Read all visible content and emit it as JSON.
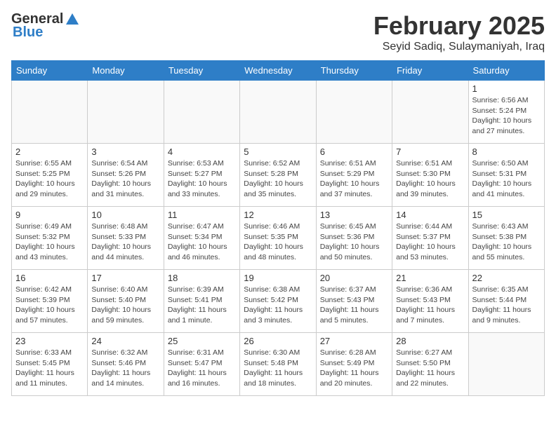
{
  "header": {
    "logo_general": "General",
    "logo_blue": "Blue",
    "month_title": "February 2025",
    "subtitle": "Seyid Sadiq, Sulaymaniyah, Iraq"
  },
  "weekdays": [
    "Sunday",
    "Monday",
    "Tuesday",
    "Wednesday",
    "Thursday",
    "Friday",
    "Saturday"
  ],
  "weeks": [
    [
      {
        "day": "",
        "info": ""
      },
      {
        "day": "",
        "info": ""
      },
      {
        "day": "",
        "info": ""
      },
      {
        "day": "",
        "info": ""
      },
      {
        "day": "",
        "info": ""
      },
      {
        "day": "",
        "info": ""
      },
      {
        "day": "1",
        "info": "Sunrise: 6:56 AM\nSunset: 5:24 PM\nDaylight: 10 hours and 27 minutes."
      }
    ],
    [
      {
        "day": "2",
        "info": "Sunrise: 6:55 AM\nSunset: 5:25 PM\nDaylight: 10 hours and 29 minutes."
      },
      {
        "day": "3",
        "info": "Sunrise: 6:54 AM\nSunset: 5:26 PM\nDaylight: 10 hours and 31 minutes."
      },
      {
        "day": "4",
        "info": "Sunrise: 6:53 AM\nSunset: 5:27 PM\nDaylight: 10 hours and 33 minutes."
      },
      {
        "day": "5",
        "info": "Sunrise: 6:52 AM\nSunset: 5:28 PM\nDaylight: 10 hours and 35 minutes."
      },
      {
        "day": "6",
        "info": "Sunrise: 6:51 AM\nSunset: 5:29 PM\nDaylight: 10 hours and 37 minutes."
      },
      {
        "day": "7",
        "info": "Sunrise: 6:51 AM\nSunset: 5:30 PM\nDaylight: 10 hours and 39 minutes."
      },
      {
        "day": "8",
        "info": "Sunrise: 6:50 AM\nSunset: 5:31 PM\nDaylight: 10 hours and 41 minutes."
      }
    ],
    [
      {
        "day": "9",
        "info": "Sunrise: 6:49 AM\nSunset: 5:32 PM\nDaylight: 10 hours and 43 minutes."
      },
      {
        "day": "10",
        "info": "Sunrise: 6:48 AM\nSunset: 5:33 PM\nDaylight: 10 hours and 44 minutes."
      },
      {
        "day": "11",
        "info": "Sunrise: 6:47 AM\nSunset: 5:34 PM\nDaylight: 10 hours and 46 minutes."
      },
      {
        "day": "12",
        "info": "Sunrise: 6:46 AM\nSunset: 5:35 PM\nDaylight: 10 hours and 48 minutes."
      },
      {
        "day": "13",
        "info": "Sunrise: 6:45 AM\nSunset: 5:36 PM\nDaylight: 10 hours and 50 minutes."
      },
      {
        "day": "14",
        "info": "Sunrise: 6:44 AM\nSunset: 5:37 PM\nDaylight: 10 hours and 53 minutes."
      },
      {
        "day": "15",
        "info": "Sunrise: 6:43 AM\nSunset: 5:38 PM\nDaylight: 10 hours and 55 minutes."
      }
    ],
    [
      {
        "day": "16",
        "info": "Sunrise: 6:42 AM\nSunset: 5:39 PM\nDaylight: 10 hours and 57 minutes."
      },
      {
        "day": "17",
        "info": "Sunrise: 6:40 AM\nSunset: 5:40 PM\nDaylight: 10 hours and 59 minutes."
      },
      {
        "day": "18",
        "info": "Sunrise: 6:39 AM\nSunset: 5:41 PM\nDaylight: 11 hours and 1 minute."
      },
      {
        "day": "19",
        "info": "Sunrise: 6:38 AM\nSunset: 5:42 PM\nDaylight: 11 hours and 3 minutes."
      },
      {
        "day": "20",
        "info": "Sunrise: 6:37 AM\nSunset: 5:43 PM\nDaylight: 11 hours and 5 minutes."
      },
      {
        "day": "21",
        "info": "Sunrise: 6:36 AM\nSunset: 5:43 PM\nDaylight: 11 hours and 7 minutes."
      },
      {
        "day": "22",
        "info": "Sunrise: 6:35 AM\nSunset: 5:44 PM\nDaylight: 11 hours and 9 minutes."
      }
    ],
    [
      {
        "day": "23",
        "info": "Sunrise: 6:33 AM\nSunset: 5:45 PM\nDaylight: 11 hours and 11 minutes."
      },
      {
        "day": "24",
        "info": "Sunrise: 6:32 AM\nSunset: 5:46 PM\nDaylight: 11 hours and 14 minutes."
      },
      {
        "day": "25",
        "info": "Sunrise: 6:31 AM\nSunset: 5:47 PM\nDaylight: 11 hours and 16 minutes."
      },
      {
        "day": "26",
        "info": "Sunrise: 6:30 AM\nSunset: 5:48 PM\nDaylight: 11 hours and 18 minutes."
      },
      {
        "day": "27",
        "info": "Sunrise: 6:28 AM\nSunset: 5:49 PM\nDaylight: 11 hours and 20 minutes."
      },
      {
        "day": "28",
        "info": "Sunrise: 6:27 AM\nSunset: 5:50 PM\nDaylight: 11 hours and 22 minutes."
      },
      {
        "day": "",
        "info": ""
      }
    ]
  ]
}
